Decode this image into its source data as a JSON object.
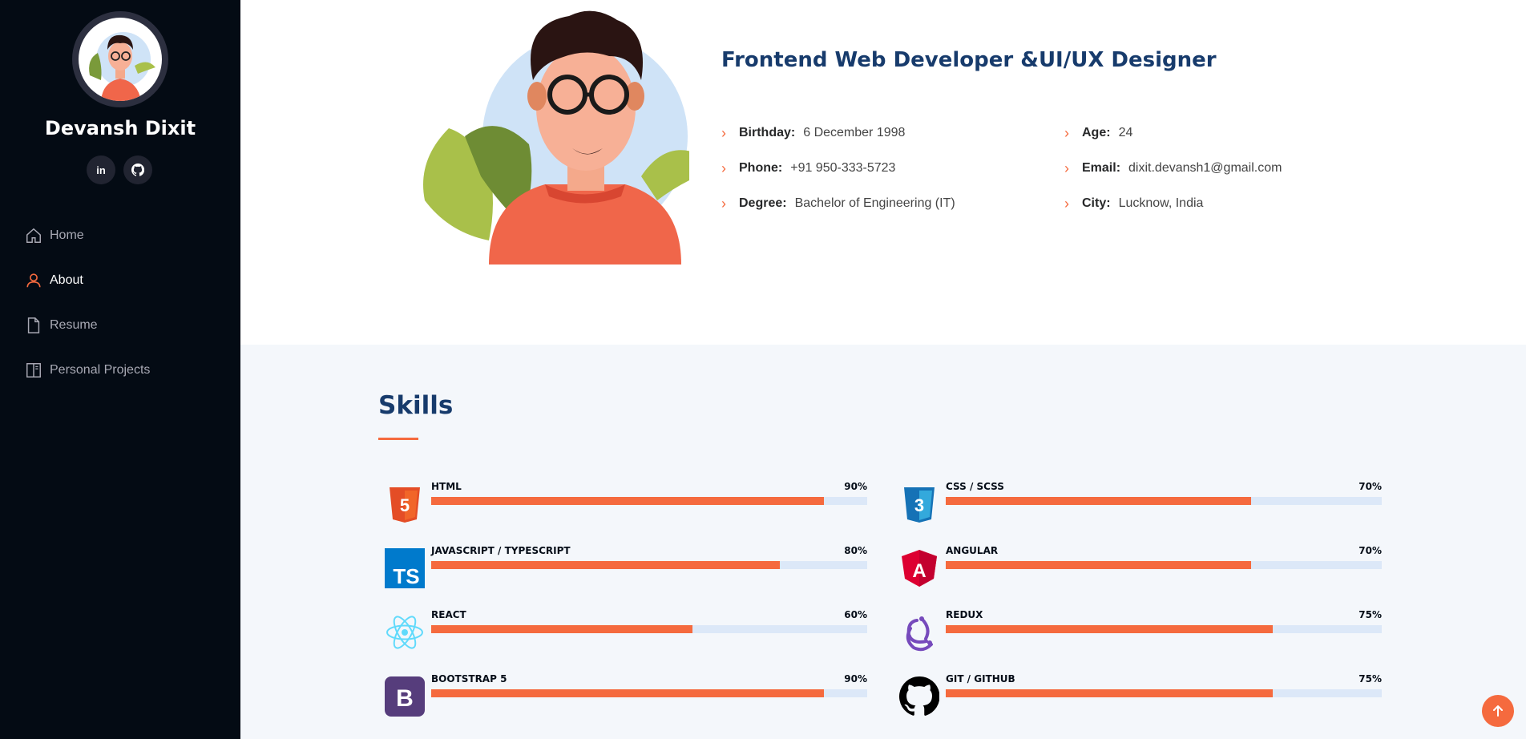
{
  "sidebar": {
    "name": "Devansh Dixit",
    "socials": [
      {
        "icon": "linkedin-icon",
        "glyph": "in"
      },
      {
        "icon": "github-icon",
        "glyph": ""
      }
    ],
    "nav": [
      {
        "label": "Home",
        "icon": "home-icon",
        "active": false
      },
      {
        "label": "About",
        "icon": "person-icon",
        "active": true
      },
      {
        "label": "Resume",
        "icon": "file-icon",
        "active": false
      },
      {
        "label": "Personal Projects",
        "icon": "book-icon",
        "active": false
      }
    ]
  },
  "about": {
    "title": "Frontend Web Developer &UI/UX Designer",
    "left": [
      {
        "label": "Birthday:",
        "value": "6 December 1998"
      },
      {
        "label": "Phone:",
        "value": "+91 950-333-5723"
      },
      {
        "label": "Degree:",
        "value": "Bachelor of Engineering (IT)"
      }
    ],
    "right": [
      {
        "label": "Age:",
        "value": "24"
      },
      {
        "label": "Email:",
        "value": "dixit.devansh1@gmail.com"
      },
      {
        "label": "City:",
        "value": "Lucknow, India"
      }
    ]
  },
  "skills": {
    "title": "Skills",
    "items": [
      {
        "name": "HTML",
        "percent": "90%",
        "value": 90,
        "icon": "html5-icon",
        "color": "#e44d26"
      },
      {
        "name": "CSS / SCSS",
        "percent": "70%",
        "value": 70,
        "icon": "css3-icon",
        "color": "#1572b6"
      },
      {
        "name": "JAVASCRIPT / TYPESCRIPT",
        "percent": "80%",
        "value": 80,
        "icon": "typescript-icon",
        "color": "#007acc"
      },
      {
        "name": "ANGULAR",
        "percent": "70%",
        "value": 70,
        "icon": "angular-icon",
        "color": "#dd0031"
      },
      {
        "name": "REACT",
        "percent": "60%",
        "value": 60,
        "icon": "react-icon",
        "color": "#61dafb"
      },
      {
        "name": "REDUX",
        "percent": "75%",
        "value": 75,
        "icon": "redux-icon",
        "color": "#764abc"
      },
      {
        "name": "BOOTSTRAP 5",
        "percent": "90%",
        "value": 90,
        "icon": "bootstrap-icon",
        "color": "#563d7c"
      },
      {
        "name": "GIT / GITHUB",
        "percent": "75%",
        "value": 75,
        "icon": "github-icon",
        "color": "#000000"
      }
    ]
  },
  "colors": {
    "accent": "#f56a3e",
    "sidebar": "#040b14",
    "heading": "#173b6c"
  }
}
